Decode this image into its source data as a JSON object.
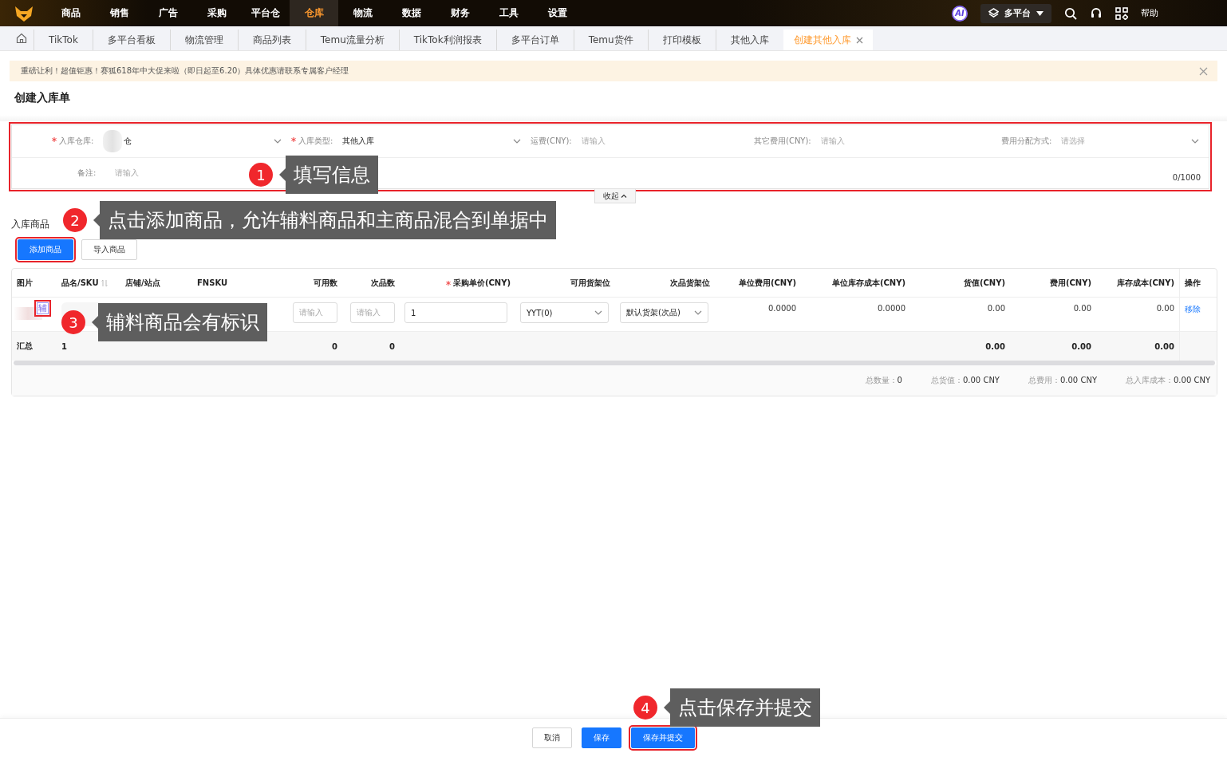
{
  "top_nav": {
    "items": [
      {
        "label": "商品",
        "selected": false
      },
      {
        "label": "销售",
        "selected": false
      },
      {
        "label": "广告",
        "selected": false
      },
      {
        "label": "采购",
        "selected": false
      },
      {
        "label": "平台仓",
        "selected": false
      },
      {
        "label": "仓库",
        "selected": true
      },
      {
        "label": "物流",
        "selected": false
      },
      {
        "label": "数据",
        "selected": false
      },
      {
        "label": "财务",
        "selected": false
      },
      {
        "label": "工具",
        "selected": false
      },
      {
        "label": "设置",
        "selected": false
      }
    ],
    "ai_badge": "AI",
    "platform": "多平台",
    "help": "帮助"
  },
  "tabs": [
    {
      "label": "TikTok",
      "selected": false
    },
    {
      "label": "多平台看板",
      "selected": false
    },
    {
      "label": "物流管理",
      "selected": false
    },
    {
      "label": "商品列表",
      "selected": false
    },
    {
      "label": "Temu流量分析",
      "selected": false
    },
    {
      "label": "TikTok利润报表",
      "selected": false
    },
    {
      "label": "多平台订单",
      "selected": false
    },
    {
      "label": "Temu货件",
      "selected": false
    },
    {
      "label": "打印模板",
      "selected": false
    },
    {
      "label": "其他入库",
      "selected": false
    },
    {
      "label": "创建其他入库",
      "selected": true
    }
  ],
  "notice": "重磅让利！超值钜惠！赛狐618年中大促来啦（即日起至6.20）具体优惠请联系专属客户经理",
  "page_title": "创建入库单",
  "form": {
    "fields": [
      {
        "label": "入库仓库:",
        "required": true,
        "kind": "select",
        "value": "仓"
      },
      {
        "label": "入库类型:",
        "required": true,
        "kind": "select",
        "value": "其他入库"
      },
      {
        "label": "运费(CNY):",
        "required": false,
        "kind": "input",
        "placeholder": "请输入"
      },
      {
        "label": "其它费用(CNY):",
        "required": false,
        "kind": "input",
        "placeholder": "请输入"
      },
      {
        "label": "费用分配方式:",
        "required": false,
        "kind": "select",
        "placeholder": "请选择"
      }
    ],
    "remark": {
      "label": "备注:",
      "placeholder": "请输入",
      "counter": "0/1000"
    },
    "collapse": "收起"
  },
  "section_title": "入库商品",
  "section_buttons": [
    {
      "label": "添加商品",
      "kind": "primary"
    },
    {
      "label": "导入商品",
      "kind": "default"
    }
  ],
  "table": {
    "columns": [
      {
        "label": "图片",
        "required": false,
        "sortable": false
      },
      {
        "label": "品名/SKU",
        "required": false,
        "sortable": true
      },
      {
        "label": "店铺/站点",
        "required": false,
        "sortable": false
      },
      {
        "label": "FNSKU",
        "required": false,
        "sortable": false
      },
      {
        "label": "可用数",
        "required": false,
        "sortable": false
      },
      {
        "label": "次品数",
        "required": false,
        "sortable": false
      },
      {
        "label": "采购单价(CNY)",
        "required": true,
        "sortable": false
      },
      {
        "label": "可用货架位",
        "required": false,
        "sortable": false
      },
      {
        "label": "次品货架位",
        "required": false,
        "sortable": false
      },
      {
        "label": "单位费用(CNY)",
        "required": false,
        "sortable": false
      },
      {
        "label": "单位库存成本(CNY)",
        "required": false,
        "sortable": false
      },
      {
        "label": "货值(CNY)",
        "required": false,
        "sortable": false
      },
      {
        "label": "费用(CNY)",
        "required": false,
        "sortable": false
      },
      {
        "label": "库存成本(CNY)",
        "required": false,
        "sortable": false
      },
      {
        "label": "操作",
        "required": false,
        "sortable": false
      }
    ],
    "rows": [
      {
        "tag": "辅",
        "available_placeholder": "请输入",
        "defect_placeholder": "请输入",
        "price": "1",
        "shelf": "YYT(0)",
        "defect_shelf": "默认货架(次品)",
        "unit_fee": "0.0000",
        "unit_cost": "0.0000",
        "value": "0.00",
        "fee": "0.00",
        "cost": "0.00",
        "action": "移除"
      }
    ],
    "summary": {
      "label": "汇总",
      "count": "1",
      "available": "0",
      "defect": "0",
      "value": "0.00",
      "fee": "0.00",
      "cost": "0.00"
    }
  },
  "totals": [
    {
      "label": "总数量：",
      "value": "0"
    },
    {
      "label": "总货值：",
      "value": "0.00 CNY"
    },
    {
      "label": "总费用：",
      "value": "0.00 CNY"
    },
    {
      "label": "总入库成本：",
      "value": "0.00 CNY"
    }
  ],
  "footer_buttons": [
    {
      "label": "取消",
      "kind": "default"
    },
    {
      "label": "保存",
      "kind": "primary"
    },
    {
      "label": "保存并提交",
      "kind": "primary"
    }
  ],
  "annotations": [
    {
      "number": "1",
      "text": "填写信息"
    },
    {
      "number": "2",
      "text": "点击添加商品，允许辅料商品和主商品混合到单据中"
    },
    {
      "number": "3",
      "text": "辅料商品会有标识"
    },
    {
      "number": "4",
      "text": "点击保存并提交"
    }
  ]
}
